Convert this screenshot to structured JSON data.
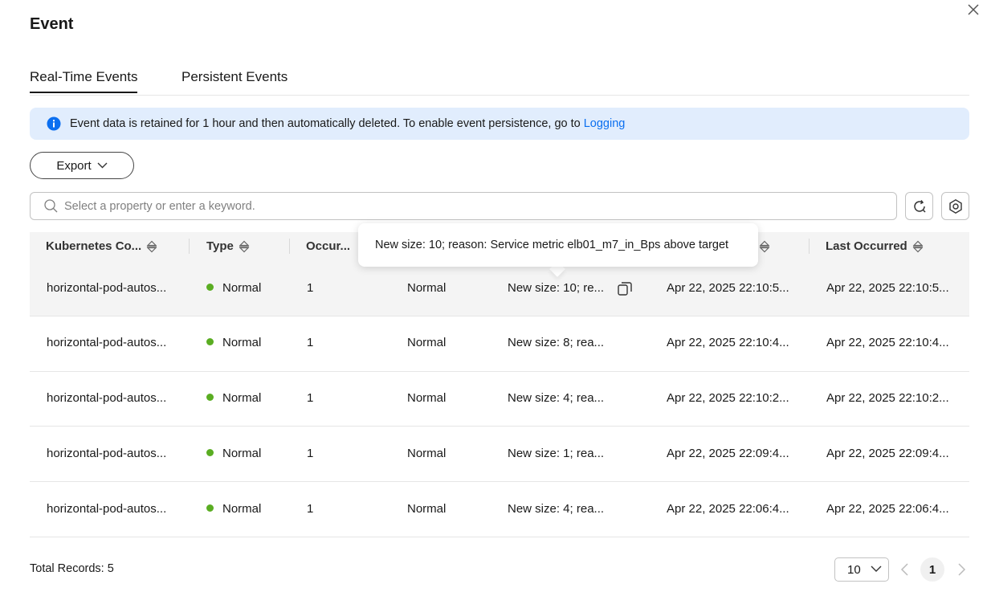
{
  "dialog": {
    "title": "Event",
    "close_icon": "close-icon"
  },
  "tabs": [
    {
      "label": "Real-Time Events",
      "active": true
    },
    {
      "label": "Persistent Events",
      "active": false
    }
  ],
  "banner": {
    "icon": "info-icon",
    "text": "Event data is retained for 1 hour and then automatically deleted. To enable event persistence, go to",
    "link": "Logging",
    "bg_color": "#e1edfd",
    "link_color": "#0b6ff0"
  },
  "toolbar": {
    "export_label": "Export",
    "search_placeholder": "Select a property or enter a keyword.",
    "refresh_icon": "refresh-icon",
    "settings_icon": "settings-icon"
  },
  "table": {
    "columns": [
      "Kubernetes Co...",
      "Type",
      "Occur...",
      "",
      "",
      "",
      "Last Occurred"
    ],
    "rows": [
      {
        "name": "horizontal-pod-autos...",
        "type": "Normal",
        "occurrences": "1",
        "level": "Normal",
        "content": "New size: 10; re...",
        "first": "Apr 22, 2025 22:10:5...",
        "last": "Apr 22, 2025 22:10:5..."
      },
      {
        "name": "horizontal-pod-autos...",
        "type": "Normal",
        "occurrences": "1",
        "level": "Normal",
        "content": "New size: 8; rea...",
        "first": "Apr 22, 2025 22:10:4...",
        "last": "Apr 22, 2025 22:10:4..."
      },
      {
        "name": "horizontal-pod-autos...",
        "type": "Normal",
        "occurrences": "1",
        "level": "Normal",
        "content": "New size: 4; rea...",
        "first": "Apr 22, 2025 22:10:2...",
        "last": "Apr 22, 2025 22:10:2..."
      },
      {
        "name": "horizontal-pod-autos...",
        "type": "Normal",
        "occurrences": "1",
        "level": "Normal",
        "content": "New size: 1; rea...",
        "first": "Apr 22, 2025 22:09:4...",
        "last": "Apr 22, 2025 22:09:4..."
      },
      {
        "name": "horizontal-pod-autos...",
        "type": "Normal",
        "occurrences": "1",
        "level": "Normal",
        "content": "New size: 4; rea...",
        "first": "Apr 22, 2025 22:06:4...",
        "last": "Apr 22, 2025 22:06:4..."
      }
    ],
    "status_color": "#5aad22"
  },
  "tooltip": {
    "text": "New size: 10; reason: Service metric elb01_m7_in_Bps above target"
  },
  "footer": {
    "total": "Total Records: 5",
    "page_size": "10",
    "current_page": "1"
  }
}
